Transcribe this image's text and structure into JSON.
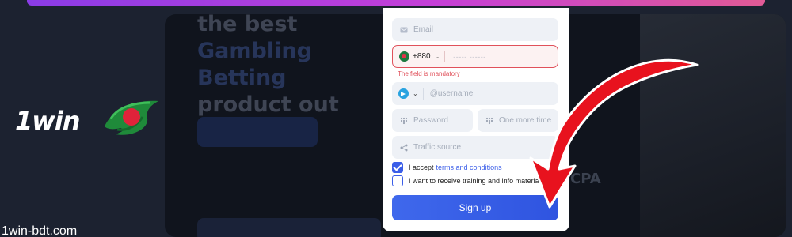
{
  "brand": {
    "logo_text": "1win",
    "watermark": "1win-bdt.com"
  },
  "background": {
    "hero_line1": "the best",
    "hero_line2": "Gambling Betting",
    "hero_line3": "product out there",
    "cpa_text": "CPA"
  },
  "form": {
    "email_placeholder": "Email",
    "phone_code": "+880",
    "phone_mask": "----- ------",
    "phone_error": "The field is mandatory",
    "messenger_placeholder": "@username",
    "password_placeholder": "Password",
    "password_repeat_placeholder": "One more time",
    "traffic_placeholder": "Traffic source",
    "terms_prefix": "I accept",
    "terms_link": "terms and conditions",
    "training_label": "I want to receive training and info materials",
    "signup_label": "Sign up",
    "terms_checked": true,
    "training_checked": false
  },
  "colors": {
    "accent": "#3b5ee8",
    "error": "#e0515b",
    "arrow": "#e8121e"
  }
}
